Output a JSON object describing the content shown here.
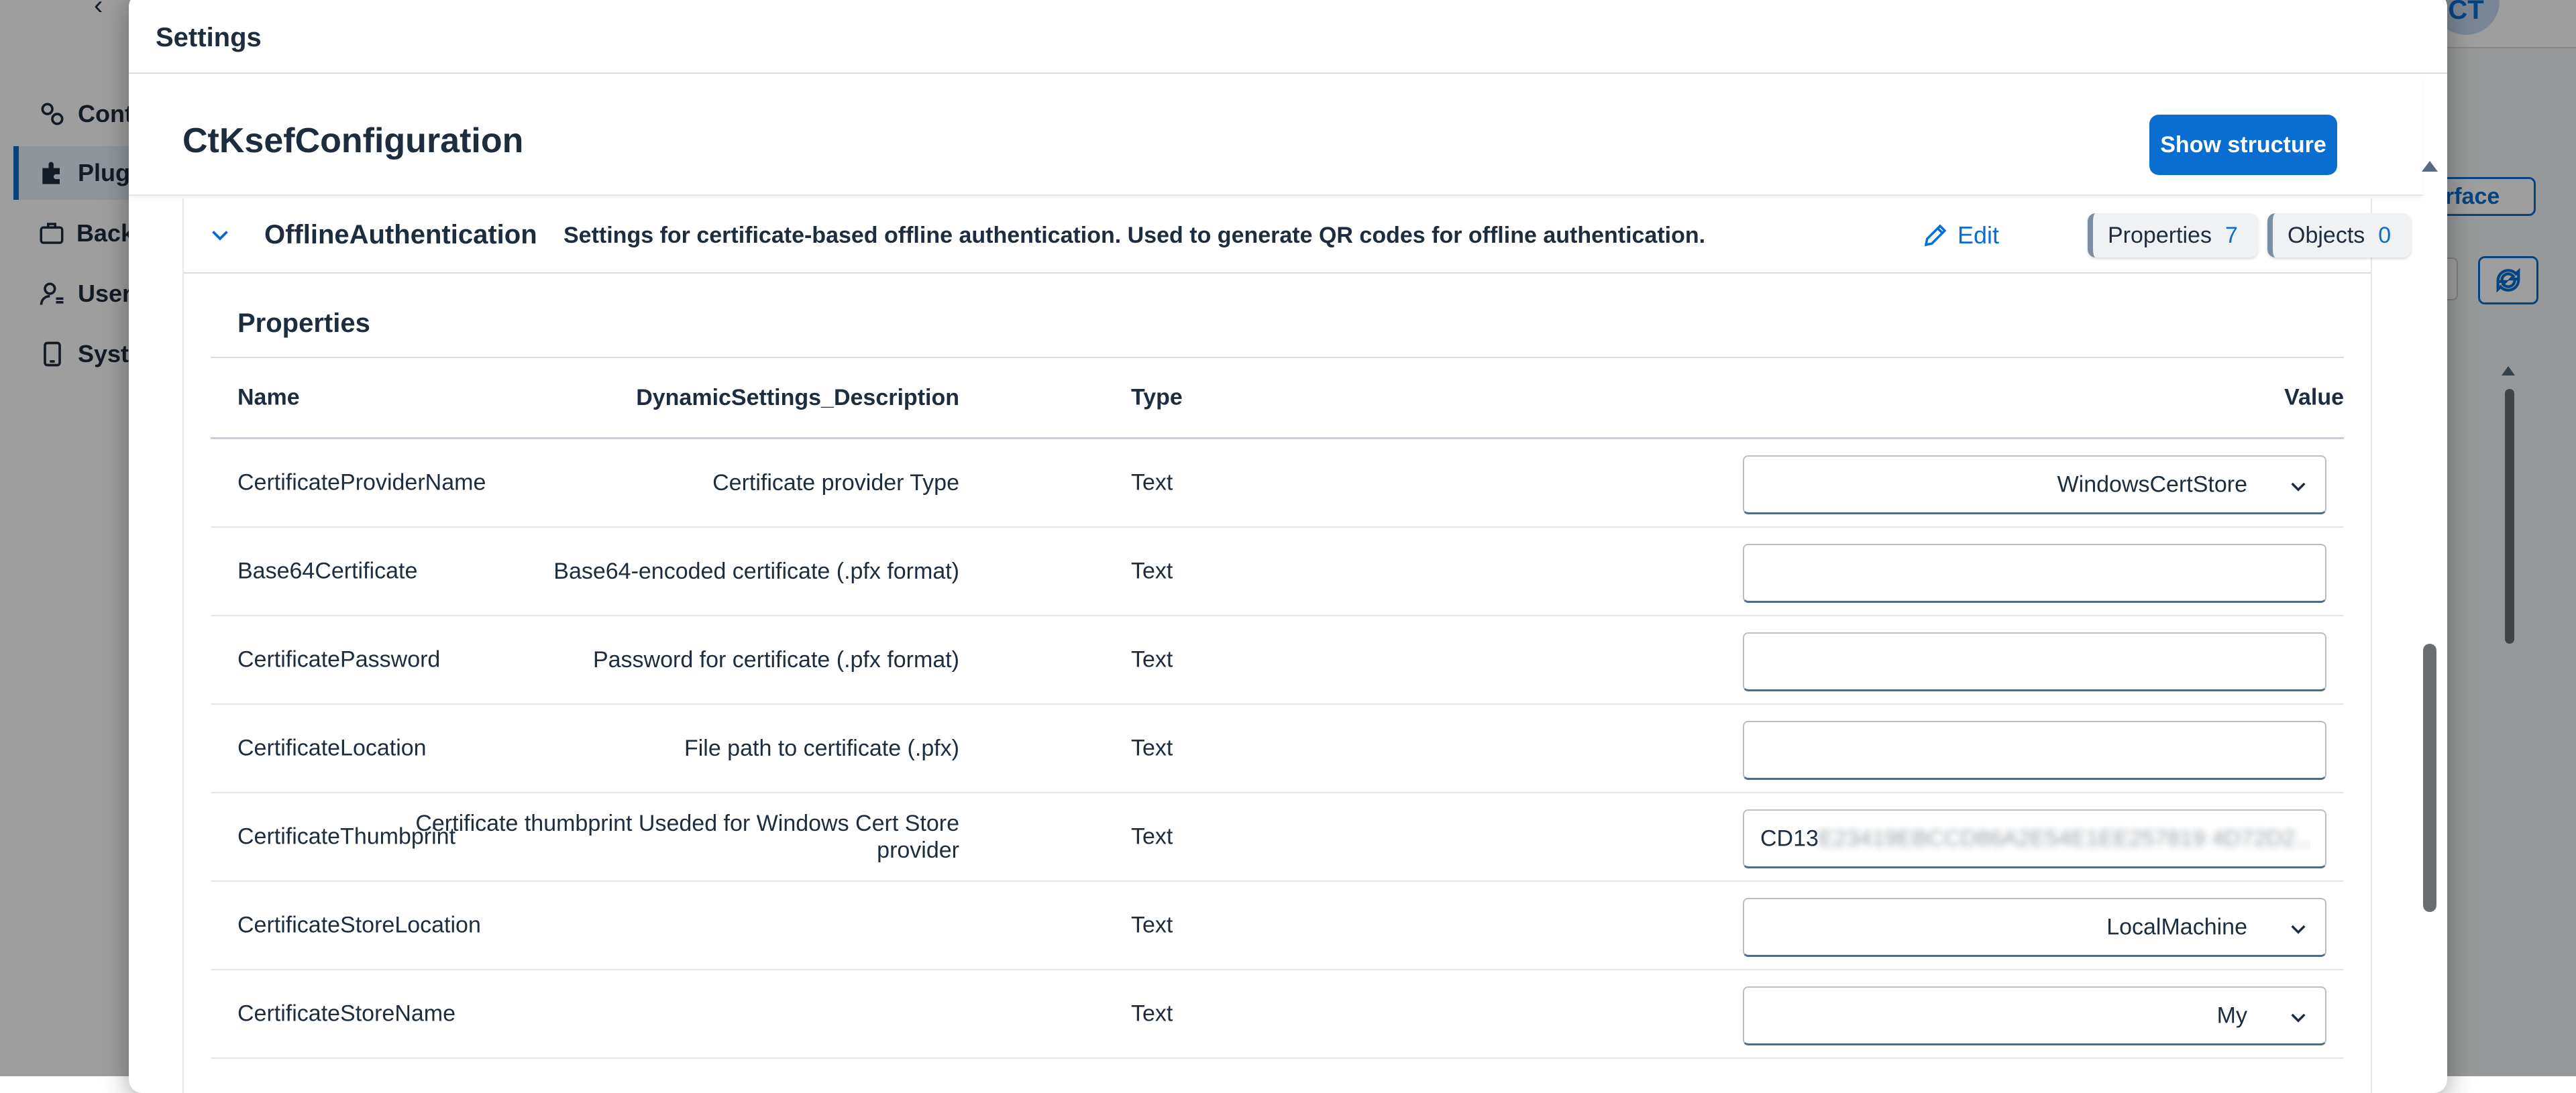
{
  "background": {
    "nav_items": [
      "Cont",
      "Plug",
      "Back",
      "User",
      "Syst"
    ],
    "avatar_initials": "CT",
    "interface_label": "rface"
  },
  "dialog": {
    "title": "Settings",
    "config_name": "CtKsefConfiguration",
    "show_structure_label": "Show structure",
    "section": {
      "name": "OfflineAuthentication",
      "description": "Settings for certificate-based offline authentication. Used to generate QR codes for offline authentication.",
      "edit_label": "Edit",
      "properties_label": "Properties",
      "properties_count": "7",
      "objects_label": "Objects",
      "objects_count": "0",
      "properties_title": "Properties",
      "columns": {
        "name": "Name",
        "description": "DynamicSettings_Description",
        "type": "Type",
        "value": "Value"
      },
      "rows": [
        {
          "name": "CertificateProviderName",
          "description": "Certificate provider Type",
          "type": "Text",
          "value": "WindowsCertStore",
          "control": "select"
        },
        {
          "name": "Base64Certificate",
          "description": "Base64-encoded certificate (.pfx format)",
          "type": "Text",
          "value": "",
          "control": "text"
        },
        {
          "name": "CertificatePassword",
          "description": "Password for certificate (.pfx format)",
          "type": "Text",
          "value": "",
          "control": "text"
        },
        {
          "name": "CertificateLocation",
          "description": "File path to certificate (.pfx)",
          "type": "Text",
          "value": "",
          "control": "text"
        },
        {
          "name": "CertificateThumbprint",
          "description": "Certificate thumbprint Useded for Windows Cert Store provider",
          "type": "Text",
          "value": "CD13",
          "value_obscured": "E23419EBCCD86A2E54E1EE257819 4D72D2...",
          "control": "text"
        },
        {
          "name": "CertificateStoreLocation",
          "description": "",
          "type": "Text",
          "value": "LocalMachine",
          "control": "select"
        },
        {
          "name": "CertificateStoreName",
          "description": "",
          "type": "Text",
          "value": "My",
          "control": "select"
        }
      ]
    }
  },
  "colors": {
    "accent": "#0a6ed1",
    "text": "#1d2d3e",
    "overlay": "rgba(0,0,0,0.38)"
  }
}
